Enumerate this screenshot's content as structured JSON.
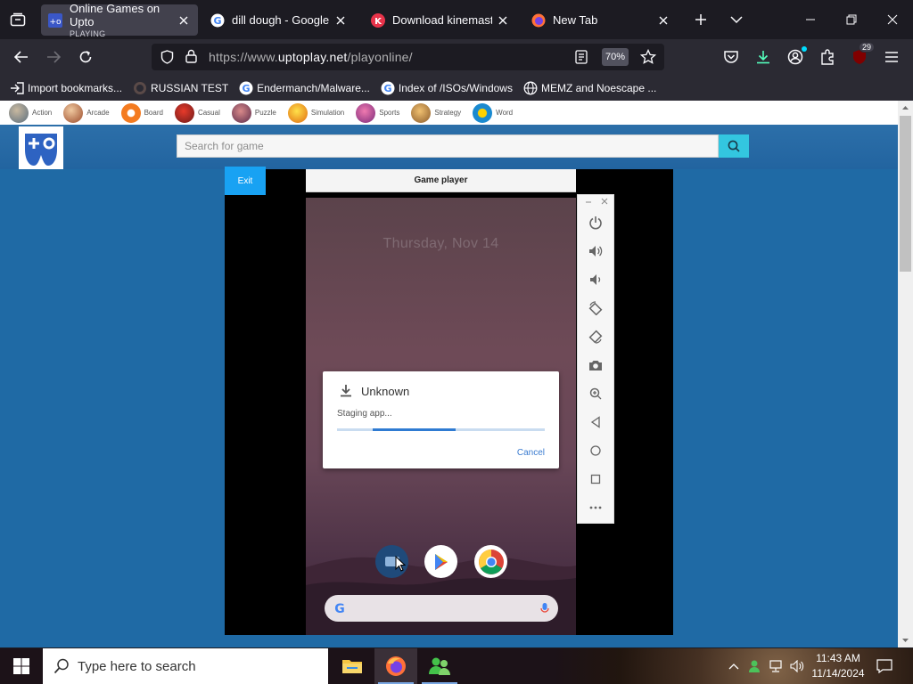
{
  "browser": {
    "tabs": [
      {
        "title": "Online Games on Upto",
        "subtitle": "PLAYING",
        "active": true
      },
      {
        "title": "dill dough - Google Se",
        "active": false
      },
      {
        "title": "Download kinemaster",
        "active": false
      },
      {
        "title": "New Tab",
        "active": false
      }
    ],
    "url_prefix": "https://www.",
    "url_domain": "uptoplay.net",
    "url_path": "/playonline/",
    "zoom": "70%",
    "extensions_badge": "29",
    "bookmarks": [
      {
        "label": "Import bookmarks...",
        "icon": "import-icon"
      },
      {
        "label": "RUSSIAN TEST",
        "icon": "ghost-icon"
      },
      {
        "label": "Endermanch/Malware...",
        "icon": "google-icon"
      },
      {
        "label": "Index of /ISOs/Windows",
        "icon": "google-icon"
      },
      {
        "label": "MEMZ and Noescape ...",
        "icon": "globe-icon"
      }
    ]
  },
  "site": {
    "categories": [
      "Action",
      "Arcade",
      "Board",
      "Casual",
      "Puzzle",
      "Simulation",
      "Sports",
      "Strategy",
      "Word"
    ],
    "search_placeholder": "Search for game",
    "exit_label": "Exit",
    "player_title": "Game player"
  },
  "phone": {
    "date": "Thursday, Nov 14",
    "dialog": {
      "title": "Unknown",
      "message": "Staging app...",
      "progress": 0.4,
      "cancel_label": "Cancel"
    }
  },
  "side_tools": [
    "power-icon",
    "volume-up-icon",
    "volume-down-icon",
    "rotate-left-icon",
    "rotate-right-icon",
    "camera-icon",
    "zoom-icon",
    "back-icon",
    "home-icon",
    "overview-icon",
    "more-icon"
  ],
  "taskbar": {
    "search_placeholder": "Type here to search",
    "time": "11:43 AM",
    "date": "11/14/2024"
  },
  "colors": {
    "page_bg": "#1f6aa5",
    "accent": "#33c6e0",
    "exit_button": "#18a2f3"
  }
}
